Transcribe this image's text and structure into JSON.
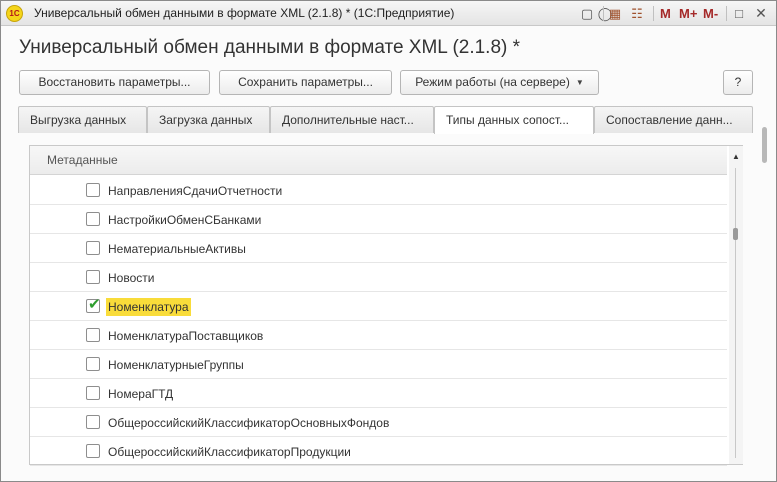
{
  "window": {
    "title": "Универсальный обмен данными в формате XML (2.1.8) * (1С:Предприятие)",
    "logo_text": "1C",
    "toolbar": {
      "m_label": "M",
      "m_plus_label": "M+",
      "m_minus_label": "M-"
    }
  },
  "header": {
    "title": "Универсальный обмен данными в формате XML (2.1.8) *"
  },
  "buttons": {
    "restore": "Восстановить параметры...",
    "save": "Сохранить параметры...",
    "mode": "Режим работы (на сервере)",
    "help": "?"
  },
  "tabs": [
    {
      "label": "Выгрузка данных"
    },
    {
      "label": "Загрузка данных"
    },
    {
      "label": "Дополнительные наст..."
    },
    {
      "label": "Типы данных сопост..."
    },
    {
      "label": "Сопоставление данн..."
    }
  ],
  "active_tab_index": 3,
  "table": {
    "column_header": "Метаданные",
    "rows": [
      {
        "label": "НаправленияСдачиОтчетности",
        "checked": false
      },
      {
        "label": "НастройкиОбменСБанками",
        "checked": false
      },
      {
        "label": "НематериальныеАктивы",
        "checked": false
      },
      {
        "label": "Новости",
        "checked": false
      },
      {
        "label": "Номенклатура",
        "checked": true
      },
      {
        "label": "НоменклатураПоставщиков",
        "checked": false
      },
      {
        "label": "НоменклатурныеГруппы",
        "checked": false
      },
      {
        "label": "НомераГТД",
        "checked": false
      },
      {
        "label": "ОбщероссийскийКлассификаторОсновныхФондов",
        "checked": false
      },
      {
        "label": "ОбщероссийскийКлассификаторПродукции",
        "checked": false
      }
    ]
  },
  "colors": {
    "selection": "#f9dc3a",
    "check": "#2e9e2e",
    "m_buttons": "#a52a2a"
  }
}
